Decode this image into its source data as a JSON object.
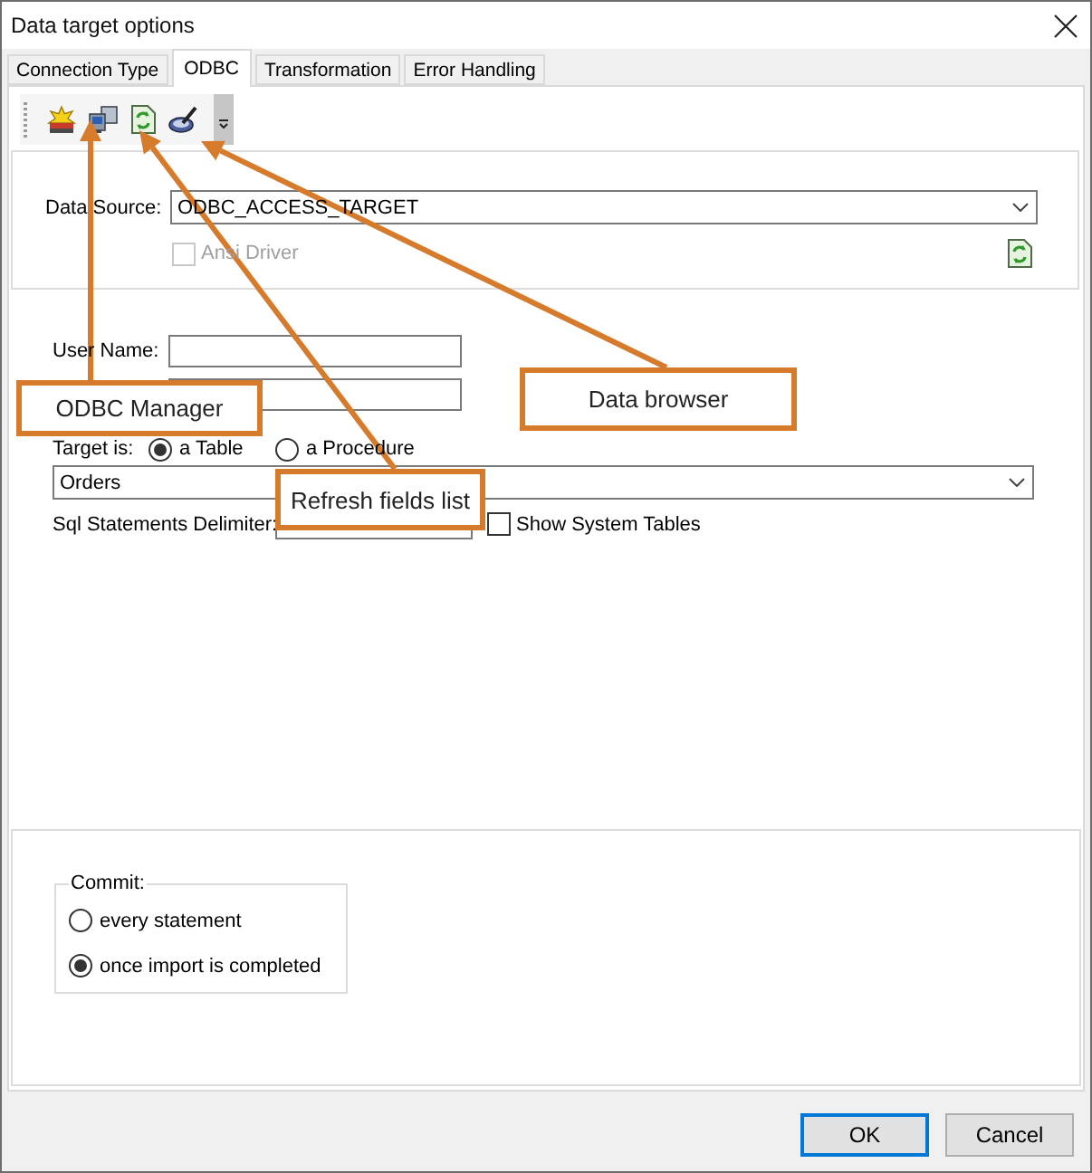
{
  "window": {
    "title": "Data target options"
  },
  "tabs": [
    {
      "label": "Connection Type",
      "selected": false
    },
    {
      "label": "ODBC",
      "selected": true
    },
    {
      "label": "Transformation",
      "selected": false
    },
    {
      "label": "Error Handling",
      "selected": false
    }
  ],
  "data_source": {
    "label": "Data Source:",
    "value": "ODBC_ACCESS_TARGET"
  },
  "ansi_driver": {
    "label": "Ansi Driver",
    "checked": false,
    "disabled": true
  },
  "user_name": {
    "label": "User Name:"
  },
  "target": {
    "label": "Target is:",
    "options": [
      {
        "label": "a Table",
        "selected": true
      },
      {
        "label": "a Procedure",
        "selected": false
      }
    ]
  },
  "table": {
    "value": "Orders"
  },
  "sql_statements_delimiter": {
    "label": "Sql Statements Delimiter:"
  },
  "show_system_tables": {
    "label": "Show System Tables",
    "checked": false
  },
  "commit": {
    "legend": "Commit:",
    "options": [
      {
        "label": "every statement",
        "selected": false
      },
      {
        "label": "once import is completed",
        "selected": true
      }
    ]
  },
  "buttons": [
    {
      "label": "OK",
      "focused": true
    },
    {
      "label": "Cancel",
      "focused": false
    }
  ],
  "callouts": [
    {
      "label": "ODBC Manager"
    },
    {
      "label": "Data browser"
    },
    {
      "label": "Refresh fields list"
    }
  ]
}
